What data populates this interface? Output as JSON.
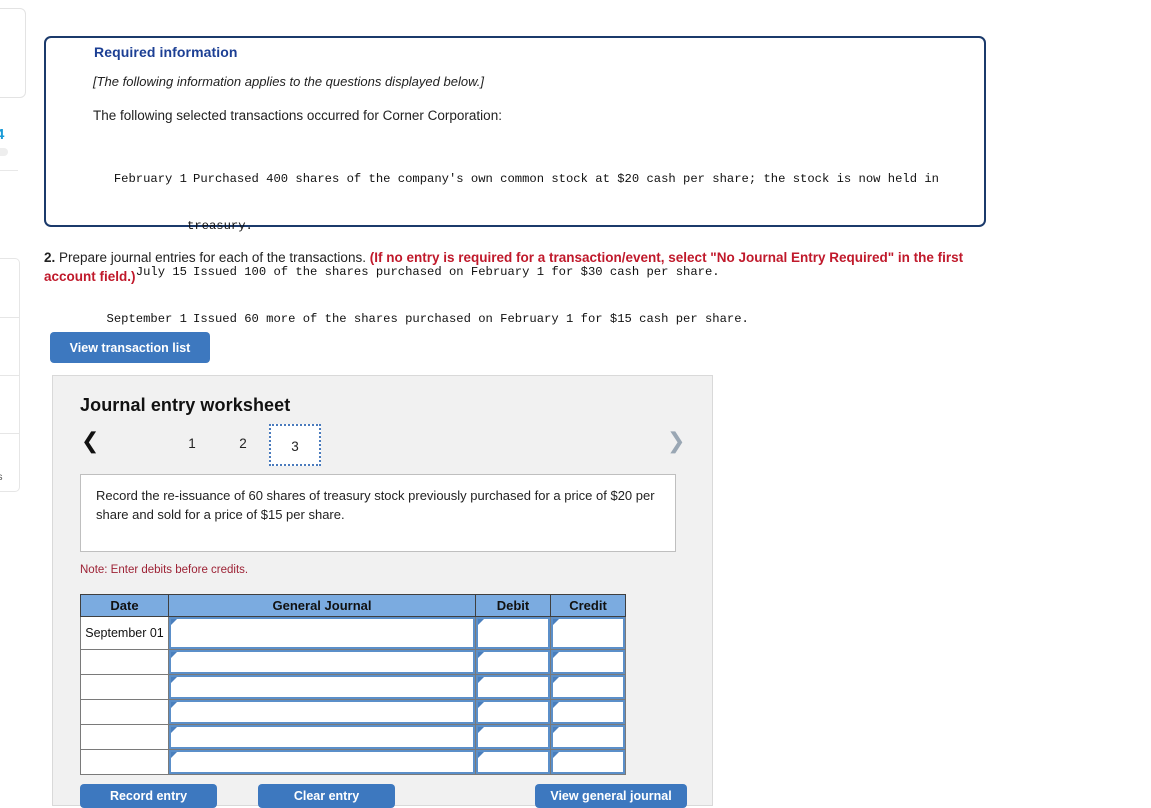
{
  "left_chrome": {
    "badge": "4",
    "clipped_text": "es"
  },
  "required_information": {
    "title": "Required information",
    "italic_note": "[The following information applies to the questions displayed below.]",
    "lead_in": "The following selected transactions occurred for Corner Corporation:",
    "transactions": [
      {
        "date": "February 1",
        "text": "Purchased 400 shares of the company's own common stock at $20 cash per share; the stock is now held in",
        "continuation": "treasury."
      },
      {
        "date": "July 15",
        "text": "Issued 100 of the shares purchased on February 1 for $30 cash per share.",
        "continuation": ""
      },
      {
        "date": "September 1",
        "text": "Issued 60 more of the shares purchased on February 1 for $15 cash per share.",
        "continuation": ""
      }
    ]
  },
  "question": {
    "number": "2.",
    "prompt": "Prepare journal entries for each of the transactions.",
    "emphasis": "(If no entry is required for a transaction/event, select \"No Journal Entry Required\" in the first account field.)"
  },
  "toolbar": {
    "view_transaction_list_label": "View transaction list"
  },
  "worksheet": {
    "title": "Journal entry worksheet",
    "prev_icon": "chevron-left-icon",
    "next_icon": "chevron-right-icon",
    "tabs": [
      {
        "label": "1",
        "selected": false
      },
      {
        "label": "2",
        "selected": false
      },
      {
        "label": "3",
        "selected": true
      }
    ],
    "instruction": "Record the re-issuance of 60 shares of treasury stock previously purchased for a price of $20 per share and sold for a price of $15 per share.",
    "note": "Note: Enter debits before credits.",
    "table": {
      "headers": [
        "Date",
        "General Journal",
        "Debit",
        "Credit"
      ],
      "rows": [
        {
          "date": "September 01",
          "general_journal": "",
          "debit": "",
          "credit": ""
        },
        {
          "date": "",
          "general_journal": "",
          "debit": "",
          "credit": ""
        },
        {
          "date": "",
          "general_journal": "",
          "debit": "",
          "credit": ""
        },
        {
          "date": "",
          "general_journal": "",
          "debit": "",
          "credit": ""
        },
        {
          "date": "",
          "general_journal": "",
          "debit": "",
          "credit": ""
        },
        {
          "date": "",
          "general_journal": "",
          "debit": "",
          "credit": ""
        }
      ]
    },
    "buttons": {
      "record_entry": "Record entry",
      "clear_entry": "Clear entry",
      "view_general_journal": "View general journal"
    }
  },
  "colors": {
    "panel_border": "#1b3a6b",
    "heading_blue": "#1c3f94",
    "button_blue": "#3d78bf",
    "table_header_blue": "#7babe0",
    "note_red": "#9d2235",
    "emphasis_red": "#c0192b"
  }
}
